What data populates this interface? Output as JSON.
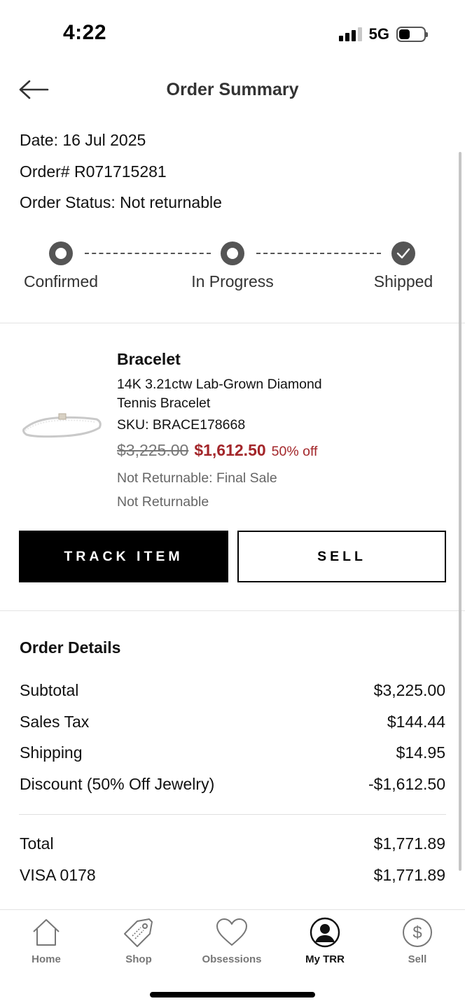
{
  "status_bar": {
    "time": "4:22",
    "network": "5G",
    "battery_level": 0.45
  },
  "header": {
    "title": "Order Summary",
    "back_icon": "arrow-left-icon"
  },
  "order": {
    "date": "Date: 16 Jul 2025",
    "number": "Order# R071715281",
    "status": "Order Status: Not returnable"
  },
  "steps": [
    {
      "label": "Confirmed",
      "state": "pending"
    },
    {
      "label": "In Progress",
      "state": "pending"
    },
    {
      "label": "Shipped",
      "state": "complete"
    }
  ],
  "product": {
    "brand": "Bracelet",
    "name": "14K 3.21ctw Lab-Grown Diamond Tennis Bracelet",
    "sku": "SKU: BRACE178668",
    "original_price": "$3,225.00",
    "sale_price": "$1,612.50",
    "discount": "50% off",
    "return_policy": "Not Returnable: Final Sale",
    "return_status": "Not Returnable",
    "image_icon": "tennis-bracelet-image"
  },
  "actions": {
    "track": "TRACK ITEM",
    "sell": "SELL"
  },
  "order_details": {
    "title": "Order Details",
    "lines": [
      {
        "label": "Subtotal",
        "value": "$3,225.00"
      },
      {
        "label": "Sales Tax",
        "value": "$144.44"
      },
      {
        "label": "Shipping",
        "value": "$14.95"
      },
      {
        "label": "Discount (50% Off Jewelry)",
        "value": "-$1,612.50"
      }
    ],
    "totals": [
      {
        "label": "Total",
        "value": "$1,771.89"
      },
      {
        "label": "VISA 0178",
        "value": "$1,771.89"
      }
    ]
  },
  "tabs": [
    {
      "label": "Home",
      "icon": "home-icon",
      "active": false
    },
    {
      "label": "Shop",
      "icon": "tag-icon",
      "active": false
    },
    {
      "label": "Obsessions",
      "icon": "heart-icon",
      "active": false
    },
    {
      "label": "My TRR",
      "icon": "profile-icon",
      "active": true
    },
    {
      "label": "Sell",
      "icon": "dollar-icon",
      "active": false
    }
  ],
  "colors": {
    "sale_red": "#a3262a",
    "step_gray": "#555555",
    "primary": "#000000"
  }
}
